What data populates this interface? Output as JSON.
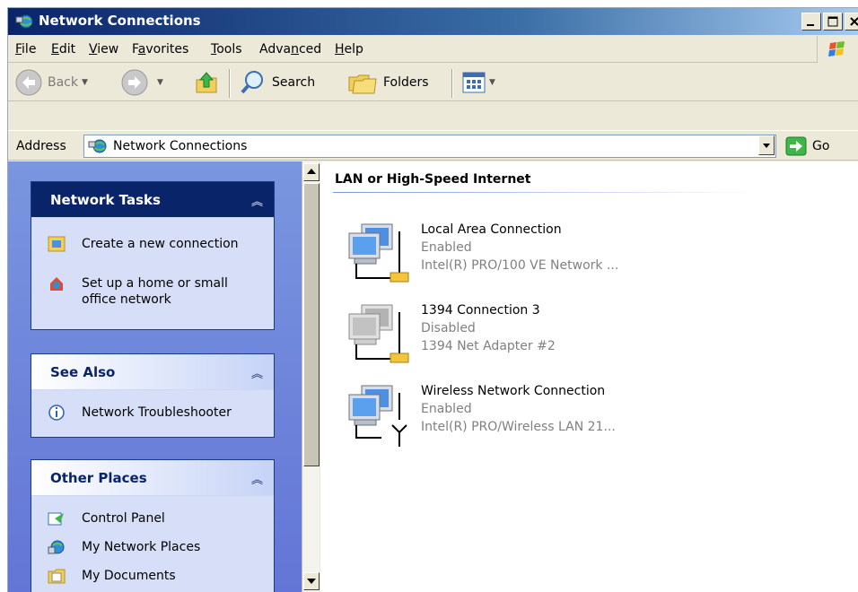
{
  "window": {
    "title": "Network Connections",
    "icon": "network-connections-icon"
  },
  "menu": [
    {
      "label": "File",
      "mnemonic": "F"
    },
    {
      "label": "Edit",
      "mnemonic": "E"
    },
    {
      "label": "View",
      "mnemonic": "V"
    },
    {
      "label": "Favorites",
      "mnemonic": "a"
    },
    {
      "label": "Tools",
      "mnemonic": "T"
    },
    {
      "label": "Advanced",
      "mnemonic": "n"
    },
    {
      "label": "Help",
      "mnemonic": "H"
    }
  ],
  "toolbar": {
    "back_label": "Back",
    "search_label": "Search",
    "folders_label": "Folders"
  },
  "address": {
    "label": "Address",
    "value": "Network Connections",
    "go_label": "Go"
  },
  "side_panel": {
    "network_tasks": {
      "title": "Network Tasks",
      "items": [
        {
          "label": "Create a new connection",
          "icon": "new-connection-icon"
        },
        {
          "label": "Set up a home or small office network",
          "icon": "home-network-icon"
        }
      ]
    },
    "see_also": {
      "title": "See Also",
      "items": [
        {
          "label": "Network Troubleshooter",
          "icon": "info-icon"
        }
      ]
    },
    "other_places": {
      "title": "Other Places",
      "items": [
        {
          "label": "Control Panel",
          "icon": "control-panel-icon"
        },
        {
          "label": "My Network Places",
          "icon": "network-places-icon"
        },
        {
          "label": "My Documents",
          "icon": "documents-icon"
        }
      ]
    }
  },
  "content": {
    "group_title": "LAN or High-Speed Internet",
    "connections": [
      {
        "name": "Local Area Connection",
        "status": "Enabled",
        "device": "Intel(R) PRO/100 VE Network ...",
        "type": "wired",
        "enabled": true
      },
      {
        "name": "1394 Connection 3",
        "status": "Disabled",
        "device": "1394 Net Adapter #2",
        "type": "wired",
        "enabled": false
      },
      {
        "name": "Wireless Network Connection",
        "status": "Enabled",
        "device": "Intel(R) PRO/Wireless LAN 21...",
        "type": "wireless",
        "enabled": true
      }
    ]
  },
  "colors": {
    "title_bar": "#0a246a",
    "task_panel": "#6375d6",
    "task_header": "#0a246a",
    "disabled_text": "#808080"
  }
}
